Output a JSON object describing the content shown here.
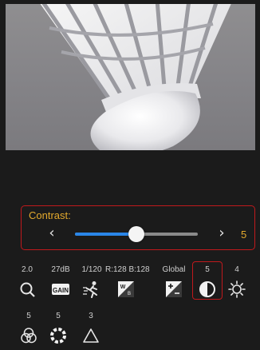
{
  "preview": {
    "subject": "shuttlecock"
  },
  "contrast": {
    "label": "Contrast:",
    "value": "5",
    "slider_fraction": 0.5
  },
  "toolbar": [
    {
      "id": "focus",
      "value": "2.0",
      "icon": "magnifier-icon"
    },
    {
      "id": "gain",
      "value": "27dB",
      "icon": "gain-icon",
      "icon_text": "GAIN"
    },
    {
      "id": "shutter",
      "value": "1/120",
      "icon": "running-man-icon"
    },
    {
      "id": "white-balance",
      "value": "R:128 B:128",
      "icon": "white-balance-icon"
    },
    {
      "id": "exposure",
      "value": "Global",
      "icon": "exposure-compensation-icon"
    },
    {
      "id": "contrast",
      "value": "5",
      "icon": "contrast-icon",
      "selected": true
    },
    {
      "id": "brightness",
      "value": "4",
      "icon": "sun-icon"
    },
    {
      "id": "saturation",
      "value": "5",
      "icon": "rgb-circles-icon"
    },
    {
      "id": "sharpness",
      "value": "5",
      "icon": "dotted-circle-icon"
    },
    {
      "id": "gamma",
      "value": "3",
      "icon": "triangle-icon"
    }
  ],
  "colors": {
    "accent": "#e3a92d",
    "selection": "#c0191c",
    "slider": "#2a86e8"
  }
}
